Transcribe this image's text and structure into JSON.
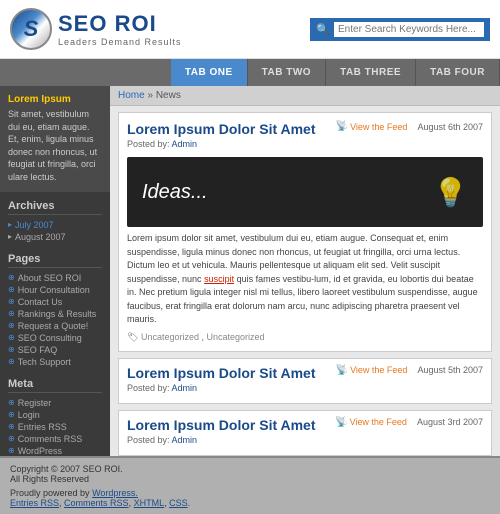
{
  "header": {
    "logo_s": "S",
    "logo_name": "SEO ROI",
    "logo_tagline": "Leaders Demand Results",
    "search_placeholder": "Enter Search Keywords Here..."
  },
  "nav": {
    "tabs": [
      {
        "label": "TAB ONE",
        "active": true
      },
      {
        "label": "TaB TWo",
        "active": false
      },
      {
        "label": "Tab Three",
        "active": false
      },
      {
        "label": "TAB FouR",
        "active": false
      }
    ]
  },
  "sidebar": {
    "highlight_title": "Lorem Ipsum",
    "highlight_text": "Sit amet, vestibulum dui eu, etiam augue. Et, enim, ligula minus donec non rhoncus, ut feugiat ut fringilla, orci ulare lectus.",
    "archives_title": "Archives",
    "archives": [
      {
        "label": "July 2007",
        "active": true
      },
      {
        "label": "August 2007",
        "active": false
      }
    ],
    "pages_title": "Pages",
    "pages": [
      "About SEO ROI",
      "Hour Consultation",
      "Contact Us",
      "Rankings & Results",
      "Request a Quote!",
      "SEO Consulting",
      "SEO FAQ",
      "Tech Support"
    ],
    "meta_title": "Meta",
    "meta": [
      "Register",
      "Login",
      "Entries RSS",
      "Comments RSS",
      "WordPress"
    ]
  },
  "breadcrumb": {
    "home": "Home",
    "separator": "»",
    "current": "News"
  },
  "posts": [
    {
      "id": 1,
      "title": "Lorem Ipsum Dolor Sit Amet",
      "posted_by_label": "Posted by:",
      "author": "Admin",
      "feed_label": "View the Feed",
      "date": "August 6th 2007",
      "has_banner": true,
      "banner_text": "Ideas...",
      "body": "Lorem ipsum dolor sit amet, vestibulum dui eu, etiam augue. Consequat et, enim suspendisse, ligula minus donec non rhoncus, ut feugiat ut fringilla, orci urna lectus. Dictum leo et ut vehicula. Mauris pellentesque ut aliquam elit sed. Velit suscipit suspendisse, nunc suscipit quis fames vestibu-lum, id et gravida, eu lobortis dui beatae in. Nec pretium ligula integer nisl mi tellus, libero laoreet vestibulum suspendisse, augue faucibus, erat fringilla erat dolorum nam arcu, nunc adipiscing pharetra praesent vel mauris.",
      "body_link_text": "suscipit",
      "tags_label": "Uncategorized , Uncategorized"
    },
    {
      "id": 2,
      "title": "Lorem Ipsum Dolor Sit Amet",
      "posted_by_label": "Posted by:",
      "author": "Admin",
      "feed_label": "View the Feed",
      "date": "August 5th 2007",
      "has_banner": false
    },
    {
      "id": 3,
      "title": "Lorem Ipsum Dolor Sit Amet",
      "posted_by_label": "Posted by:",
      "author": "Admin",
      "feed_label": "View the Feed",
      "date": "August 3rd 2007",
      "has_banner": false
    }
  ],
  "footer": {
    "copyright": "Copyright © 2007 SEO ROI.",
    "rights": "All Rights Reserved",
    "powered_label": "Proudly powered by",
    "powered_link": "Wordpress.",
    "links": "Entries RSS, Comments RSS, XHTML, CSS."
  }
}
